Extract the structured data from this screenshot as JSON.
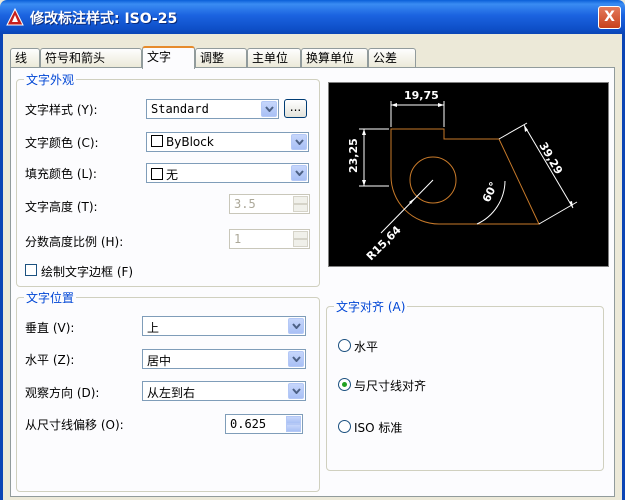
{
  "window": {
    "title": "修改标注样式: ISO-25",
    "close_label": "X"
  },
  "tabs": [
    {
      "label": "线"
    },
    {
      "label": "符号和箭头"
    },
    {
      "label": "文字"
    },
    {
      "label": "调整"
    },
    {
      "label": "主单位"
    },
    {
      "label": "换算单位"
    },
    {
      "label": "公差"
    }
  ],
  "active_tab": "文字",
  "text_appearance": {
    "title": "文字外观",
    "style_label": "文字样式 (Y):",
    "style_value": "Standard",
    "style_button": "...",
    "color_label": "文字颜色 (C):",
    "color_value": "ByBlock",
    "fill_label": "填充颜色 (L):",
    "fill_value": "无",
    "height_label": "文字高度 (T):",
    "height_value": "3.5",
    "fraction_label": "分数高度比例 (H):",
    "fraction_value": "1",
    "frame_label": "绘制文字边框 (F)",
    "frame_checked": false
  },
  "text_placement": {
    "title": "文字位置",
    "vertical_label": "垂直 (V):",
    "vertical_value": "上",
    "horizontal_label": "水平 (Z):",
    "horizontal_value": "居中",
    "direction_label": "观察方向 (D):",
    "direction_value": "从左到右",
    "offset_label": "从尺寸线偏移 (O):",
    "offset_value": "0.625"
  },
  "text_alignment": {
    "title": "文字对齐 (A)",
    "options": [
      {
        "label": "水平",
        "checked": false
      },
      {
        "label": "与尺寸线对齐",
        "checked": true
      },
      {
        "label": "ISO 标准",
        "checked": false
      }
    ]
  },
  "preview": {
    "dim_top": "19,75",
    "dim_left": "23,25",
    "dim_right": "39,29",
    "dim_angle": "60°",
    "dim_radius": "R15,64"
  },
  "colors": {
    "title_bar": "#0b45b5",
    "group_title": "#0046d5",
    "preview_bg": "#000000",
    "geometry": "#c87a2a"
  }
}
